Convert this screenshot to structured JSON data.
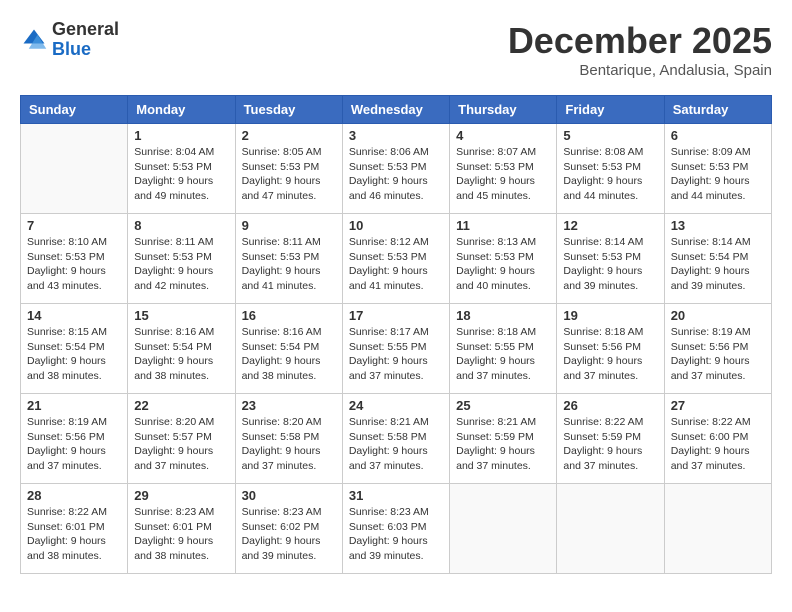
{
  "header": {
    "logo_general": "General",
    "logo_blue": "Blue",
    "month_title": "December 2025",
    "location": "Bentarique, Andalusia, Spain"
  },
  "weekdays": [
    "Sunday",
    "Monday",
    "Tuesday",
    "Wednesday",
    "Thursday",
    "Friday",
    "Saturday"
  ],
  "weeks": [
    [
      {
        "day": "",
        "info": ""
      },
      {
        "day": "1",
        "info": "Sunrise: 8:04 AM\nSunset: 5:53 PM\nDaylight: 9 hours\nand 49 minutes."
      },
      {
        "day": "2",
        "info": "Sunrise: 8:05 AM\nSunset: 5:53 PM\nDaylight: 9 hours\nand 47 minutes."
      },
      {
        "day": "3",
        "info": "Sunrise: 8:06 AM\nSunset: 5:53 PM\nDaylight: 9 hours\nand 46 minutes."
      },
      {
        "day": "4",
        "info": "Sunrise: 8:07 AM\nSunset: 5:53 PM\nDaylight: 9 hours\nand 45 minutes."
      },
      {
        "day": "5",
        "info": "Sunrise: 8:08 AM\nSunset: 5:53 PM\nDaylight: 9 hours\nand 44 minutes."
      },
      {
        "day": "6",
        "info": "Sunrise: 8:09 AM\nSunset: 5:53 PM\nDaylight: 9 hours\nand 44 minutes."
      }
    ],
    [
      {
        "day": "7",
        "info": "Sunrise: 8:10 AM\nSunset: 5:53 PM\nDaylight: 9 hours\nand 43 minutes."
      },
      {
        "day": "8",
        "info": "Sunrise: 8:11 AM\nSunset: 5:53 PM\nDaylight: 9 hours\nand 42 minutes."
      },
      {
        "day": "9",
        "info": "Sunrise: 8:11 AM\nSunset: 5:53 PM\nDaylight: 9 hours\nand 41 minutes."
      },
      {
        "day": "10",
        "info": "Sunrise: 8:12 AM\nSunset: 5:53 PM\nDaylight: 9 hours\nand 41 minutes."
      },
      {
        "day": "11",
        "info": "Sunrise: 8:13 AM\nSunset: 5:53 PM\nDaylight: 9 hours\nand 40 minutes."
      },
      {
        "day": "12",
        "info": "Sunrise: 8:14 AM\nSunset: 5:53 PM\nDaylight: 9 hours\nand 39 minutes."
      },
      {
        "day": "13",
        "info": "Sunrise: 8:14 AM\nSunset: 5:54 PM\nDaylight: 9 hours\nand 39 minutes."
      }
    ],
    [
      {
        "day": "14",
        "info": "Sunrise: 8:15 AM\nSunset: 5:54 PM\nDaylight: 9 hours\nand 38 minutes."
      },
      {
        "day": "15",
        "info": "Sunrise: 8:16 AM\nSunset: 5:54 PM\nDaylight: 9 hours\nand 38 minutes."
      },
      {
        "day": "16",
        "info": "Sunrise: 8:16 AM\nSunset: 5:54 PM\nDaylight: 9 hours\nand 38 minutes."
      },
      {
        "day": "17",
        "info": "Sunrise: 8:17 AM\nSunset: 5:55 PM\nDaylight: 9 hours\nand 37 minutes."
      },
      {
        "day": "18",
        "info": "Sunrise: 8:18 AM\nSunset: 5:55 PM\nDaylight: 9 hours\nand 37 minutes."
      },
      {
        "day": "19",
        "info": "Sunrise: 8:18 AM\nSunset: 5:56 PM\nDaylight: 9 hours\nand 37 minutes."
      },
      {
        "day": "20",
        "info": "Sunrise: 8:19 AM\nSunset: 5:56 PM\nDaylight: 9 hours\nand 37 minutes."
      }
    ],
    [
      {
        "day": "21",
        "info": "Sunrise: 8:19 AM\nSunset: 5:56 PM\nDaylight: 9 hours\nand 37 minutes."
      },
      {
        "day": "22",
        "info": "Sunrise: 8:20 AM\nSunset: 5:57 PM\nDaylight: 9 hours\nand 37 minutes."
      },
      {
        "day": "23",
        "info": "Sunrise: 8:20 AM\nSunset: 5:58 PM\nDaylight: 9 hours\nand 37 minutes."
      },
      {
        "day": "24",
        "info": "Sunrise: 8:21 AM\nSunset: 5:58 PM\nDaylight: 9 hours\nand 37 minutes."
      },
      {
        "day": "25",
        "info": "Sunrise: 8:21 AM\nSunset: 5:59 PM\nDaylight: 9 hours\nand 37 minutes."
      },
      {
        "day": "26",
        "info": "Sunrise: 8:22 AM\nSunset: 5:59 PM\nDaylight: 9 hours\nand 37 minutes."
      },
      {
        "day": "27",
        "info": "Sunrise: 8:22 AM\nSunset: 6:00 PM\nDaylight: 9 hours\nand 37 minutes."
      }
    ],
    [
      {
        "day": "28",
        "info": "Sunrise: 8:22 AM\nSunset: 6:01 PM\nDaylight: 9 hours\nand 38 minutes."
      },
      {
        "day": "29",
        "info": "Sunrise: 8:23 AM\nSunset: 6:01 PM\nDaylight: 9 hours\nand 38 minutes."
      },
      {
        "day": "30",
        "info": "Sunrise: 8:23 AM\nSunset: 6:02 PM\nDaylight: 9 hours\nand 39 minutes."
      },
      {
        "day": "31",
        "info": "Sunrise: 8:23 AM\nSunset: 6:03 PM\nDaylight: 9 hours\nand 39 minutes."
      },
      {
        "day": "",
        "info": ""
      },
      {
        "day": "",
        "info": ""
      },
      {
        "day": "",
        "info": ""
      }
    ]
  ]
}
